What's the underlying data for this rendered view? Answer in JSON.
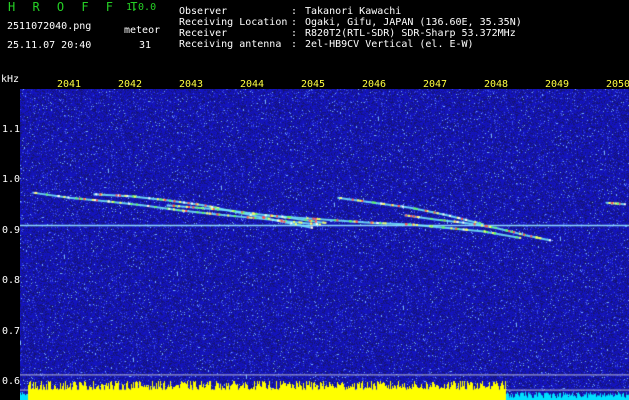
{
  "brand": {
    "name": "H R O F F T",
    "version": "1.0.0"
  },
  "capture": {
    "filename": "2511072040.png",
    "datetime": "25.11.07 20:40",
    "meteor_label": "meteor",
    "meteor_count": "31"
  },
  "station": [
    {
      "label": "Observer",
      "value": "Takanori Kawachi"
    },
    {
      "label": "Receiving Location",
      "value": "Ogaki, Gifu, JAPAN (136.60E, 35.35N)"
    },
    {
      "label": "Receiver",
      "value": "R820T2(RTL-SDR) SDR-Sharp 53.372MHz"
    },
    {
      "label": "Receiving antenna",
      "value": "2el-HB9CV Vertical (el. E-W)"
    }
  ],
  "separator": ":",
  "chart_data": {
    "type": "heatmap",
    "ylabel": "kHz",
    "y_ticks": [
      "1.1",
      "1.0",
      "0.9",
      "0.8",
      "0.7",
      "0.6"
    ],
    "y_tick_values": [
      1.1,
      1.0,
      0.9,
      0.8,
      0.7,
      0.6
    ],
    "x_ticks": [
      "2041",
      "2042",
      "2043",
      "2044",
      "2045",
      "2046",
      "2047",
      "2048",
      "2049",
      "2050"
    ],
    "x_tick_values": [
      2041,
      2042,
      2043,
      2044,
      2045,
      2046,
      2047,
      2048,
      2049,
      2050
    ],
    "ylim": [
      0.59,
      1.2
    ],
    "carrier_khz": 0.91,
    "background_color": "#1a1aa8",
    "carrier_color": "#8ad8ff",
    "power_bar_color": "#ffff00",
    "power_bar_low_color": "#00e0ff",
    "meteor_traces": [
      {
        "x": [
          2040.4,
          2041.0,
          2041.6,
          2042.2,
          2042.8,
          2043.4,
          2044.0,
          2044.6,
          2045.1
        ],
        "y": [
          0.975,
          0.965,
          0.958,
          0.95,
          0.94,
          0.932,
          0.925,
          0.918,
          0.912
        ]
      },
      {
        "x": [
          2041.4,
          2042.0,
          2042.6,
          2043.2,
          2043.8,
          2044.4,
          2045.0
        ],
        "y": [
          0.972,
          0.968,
          0.96,
          0.95,
          0.935,
          0.92,
          0.905
        ]
      },
      {
        "x": [
          2042.6,
          2043.1,
          2043.6,
          2044.1,
          2044.6,
          2045.2
        ],
        "y": [
          0.95,
          0.945,
          0.94,
          0.932,
          0.925,
          0.915
        ]
      },
      {
        "x": [
          2044.2,
          2044.8,
          2045.4,
          2046.0,
          2046.6,
          2047.2,
          2047.8,
          2048.4
        ],
        "y": [
          0.93,
          0.925,
          0.92,
          0.915,
          0.912,
          0.905,
          0.898,
          0.885
        ]
      },
      {
        "x": [
          2045.4,
          2046.0,
          2046.6,
          2047.2,
          2047.8
        ],
        "y": [
          0.965,
          0.955,
          0.945,
          0.93,
          0.912
        ]
      },
      {
        "x": [
          2046.5,
          2047.0,
          2047.5,
          2048.0,
          2048.5,
          2048.9
        ],
        "y": [
          0.93,
          0.922,
          0.915,
          0.905,
          0.89,
          0.88
        ]
      },
      {
        "x": [
          2049.8,
          2050.1
        ],
        "y": [
          0.955,
          0.952
        ]
      }
    ]
  }
}
